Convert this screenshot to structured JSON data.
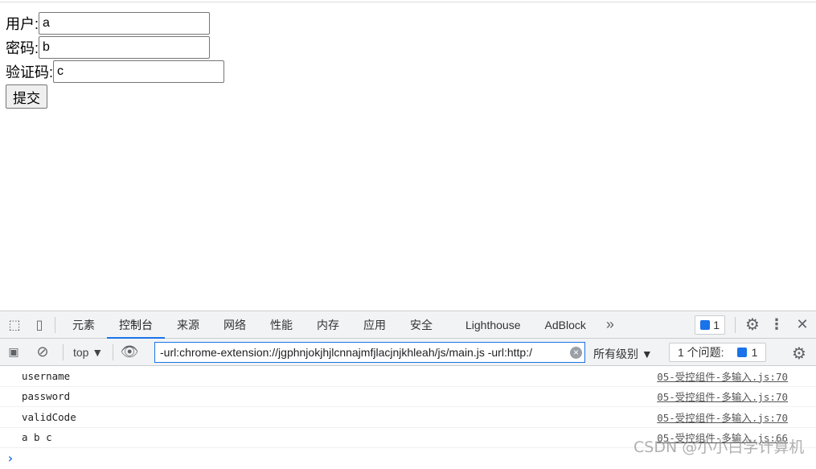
{
  "form": {
    "username_label": "用户:",
    "username_value": "a",
    "password_label": "密码:",
    "password_value": "b",
    "code_label": "验证码:",
    "code_value": "c",
    "submit_label": "提交"
  },
  "devtools": {
    "tabs": [
      "元素",
      "控制台",
      "来源",
      "网络",
      "性能",
      "内存",
      "应用",
      "安全",
      "Lighthouse",
      "AdBlock"
    ],
    "active_tab": "控制台",
    "more": "»",
    "issues_badge": "1",
    "context": "top ▼",
    "filter_value": "-url:chrome-extension://jgphnjokjhjlcnnajmfjlacjnjkhleah/js/main.js -url:http:/",
    "levels": "所有级别 ▼",
    "issues_text": "1 个问题:",
    "issues_count": "1",
    "logs": [
      {
        "msg": "username",
        "src": "05-受控组件-多输入.js:70"
      },
      {
        "msg": "password",
        "src": "05-受控组件-多输入.js:70"
      },
      {
        "msg": "validCode",
        "src": "05-受控组件-多输入.js:70"
      },
      {
        "msg": "a b c",
        "src": "05-受控组件-多输入.js:66"
      }
    ],
    "prompt": "›"
  },
  "watermark": "CSDN @小小白学计算机",
  "colors": {
    "accent": "#1a73e8",
    "toolbar": "#f1f3f4"
  }
}
